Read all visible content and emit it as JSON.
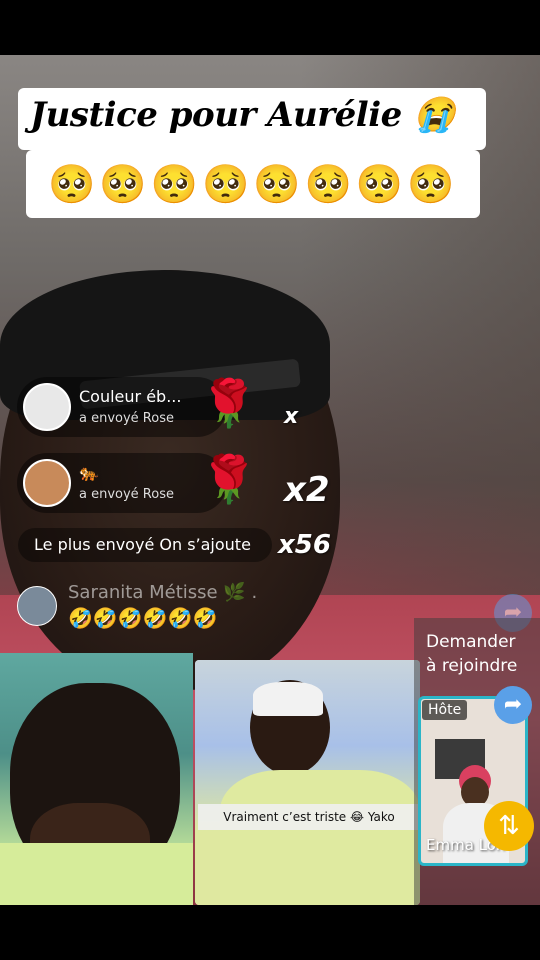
{
  "title": "Justice pour Aurélie 😭",
  "emoji_row": "🥺🥺🥺🥺🥺🥺🥺🥺",
  "gifts": [
    {
      "name": "Couleur éb...",
      "sub": "a envoyé  Rose",
      "gift_icon": "rose-icon",
      "multiplier": "x"
    },
    {
      "name": "🐅",
      "sub": "a envoyé  Rose",
      "gift_icon": "rose-icon",
      "multiplier": "x2"
    }
  ],
  "most_sent": {
    "label": "Le plus envoyé",
    "value": "On s’ajoute",
    "multiplier": "x56"
  },
  "comment": {
    "name": "Saranita Métisse 🌿 .",
    "text": "🤣🤣🤣🤣🤣🤣"
  },
  "photo_caption": "Vraiment c’est triste 😂 Yako",
  "join": {
    "label": "Demander à rejoindre"
  },
  "host": {
    "badge": "Hôte",
    "name": "Emma Lon"
  },
  "icons": {
    "share": "share-arrow-icon",
    "repeat": "repeat-icon"
  },
  "colors": {
    "accent_blue": "#5aa0e8",
    "host_border": "#2bb5c8",
    "repeat_yellow": "#f5b800"
  }
}
